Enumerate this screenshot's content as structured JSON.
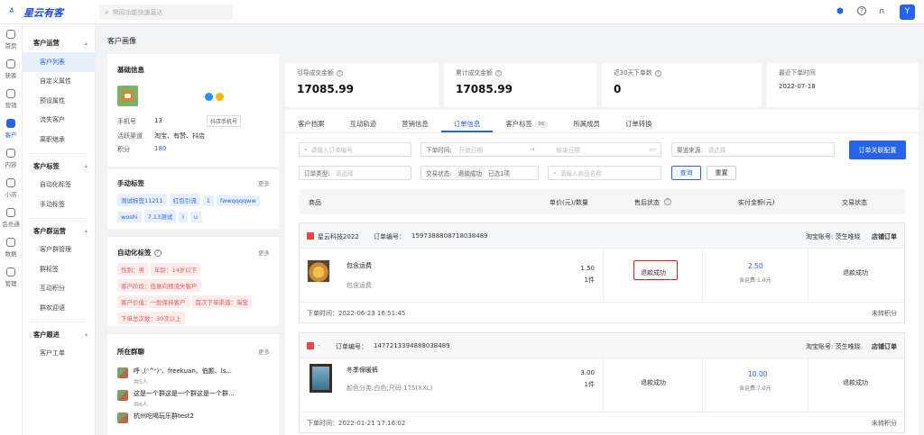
{
  "header": {
    "app_name": "星云有客",
    "search_placeholder": "常用功能快速直达",
    "avatar_text": "Y"
  },
  "rail": [
    {
      "label": "首页",
      "active": false
    },
    {
      "label": "获客",
      "active": false
    },
    {
      "label": "营销",
      "active": false
    },
    {
      "label": "客户",
      "active": true
    },
    {
      "label": "内容",
      "active": false
    },
    {
      "label": "小店",
      "active": false
    },
    {
      "label": "会员通",
      "active": false
    },
    {
      "label": "数据",
      "active": false
    },
    {
      "label": "管理",
      "active": false
    }
  ],
  "sidebar": {
    "groups": [
      {
        "title": "客户运营",
        "items": [
          "客户列表",
          "自定义属性",
          "预设属性",
          "流失客户",
          "离职继承"
        ]
      },
      {
        "title": "客户标签",
        "items": [
          "自动化标签",
          "手动标签"
        ]
      },
      {
        "title": "客户群运营",
        "items": [
          "客户群管理",
          "群标签",
          "互动积分",
          "群欢迎语"
        ]
      },
      {
        "title": "客户跟进",
        "items": [
          "客户工单"
        ]
      }
    ],
    "active_item": "客户列表"
  },
  "page": {
    "breadcrumb": "客户画像"
  },
  "basic": {
    "title": "基础信息",
    "phone_label": "手机号",
    "phone_value": "13",
    "phone_tag": "抖店手机号",
    "channel_label": "活跃渠道",
    "channel_value": "淘宝、有赞、抖店",
    "points_label": "积分",
    "points_value": "180"
  },
  "manual_tags": {
    "title": "手动标签",
    "more": "更多",
    "tags": [
      "测试标签11211",
      "红包引流",
      "1",
      "fwwqqqqww",
      "woshi",
      "7.13测试",
      "i",
      "u"
    ]
  },
  "auto_tags": {
    "title": "自动化标签",
    "more": "更多",
    "tags": [
      "性别：男",
      "年龄：14岁以下",
      "客户阶段：低意向预流失客户",
      "客户价值：一般保持客户",
      "首次下单渠道：淘宝",
      "下单总次数：30次以上"
    ]
  },
  "groups_card": {
    "title": "所在群聊",
    "more": "更多",
    "items": [
      {
        "name": "呼 ,(ᐢ^ᐢ)ᐢ、freekuan、伯颜、ls...",
        "count": "共5人"
      },
      {
        "name": "这是一个群这是一个群这是一个群...",
        "count": "共6人"
      },
      {
        "name": "杭州吃喝玩乐群test2",
        "count": ""
      }
    ]
  },
  "stats": [
    {
      "label": "引导成交金额",
      "value": "17085.99",
      "help": true
    },
    {
      "label": "累计成交金额",
      "value": "17085.99",
      "help": true
    },
    {
      "label": "近30天下单数",
      "value": "0",
      "help": true
    },
    {
      "label": "最近下单时间",
      "value": "2022-07-18",
      "help": false
    }
  ],
  "tabs": [
    {
      "label": "客户档案",
      "count": ""
    },
    {
      "label": "互动轨迹",
      "count": ""
    },
    {
      "label": "营销信息",
      "count": ""
    },
    {
      "label": "订单信息",
      "count": ""
    },
    {
      "label": "客户标签",
      "count": "98"
    },
    {
      "label": "所属成员",
      "count": ""
    },
    {
      "label": "订单转换",
      "count": ""
    }
  ],
  "filters": {
    "order_no_placeholder": "请输入订单编号",
    "order_time_label": "下单时间:",
    "start_placeholder": "开始日期",
    "end_placeholder": "结束日期",
    "channel_label": "渠道来源:",
    "channel_placeholder": "请选择",
    "type_label": "订单类型:",
    "type_placeholder": "请选择",
    "status_label": "交易状态:",
    "status_value": "退款成功",
    "status_selected": "已选1项",
    "product_placeholder": "请输入商品名称",
    "query_button": "查询",
    "reset_button": "重置",
    "config_button": "订单关联配置"
  },
  "table_headers": {
    "product": "商品",
    "price_qty": "单价(元)/数量",
    "after_sale": "售后状态",
    "paid": "实付金额(元)",
    "trade_status": "交易状态"
  },
  "orders": [
    {
      "shop": "星云科技2022",
      "order_no_label": "订单编号：",
      "order_no": "1597388808718038489",
      "account": "淘宝账号: 茨生唯晓",
      "type": "店铺订单",
      "product": "包含运费",
      "spec": "包含运费",
      "price": "1.50",
      "qty": "1件",
      "after_sale": "退款成功",
      "paid": "2.50",
      "shipping": "含运费:1.0元",
      "trade_status": "退款成功",
      "order_time": "下单时间：2022-06-23 16:51:45",
      "points": "未转积分"
    },
    {
      "shop": "-",
      "order_no_label": "订单编号：",
      "order_no": "1477213394888038489",
      "account": "淘宝账号: 茨生唯晓",
      "type": "店铺订单",
      "product": "冬季保暖裤",
      "spec": "颜色分类:白色;尺码:175(XXL)",
      "price": "3.00",
      "qty": "1件",
      "after_sale": "退款成功",
      "paid": "10.00",
      "shipping": "含运费:7.0元",
      "trade_status": "退款成功",
      "order_time": "下单时间：2022-01-21 17:16:02",
      "points": "未转积分"
    }
  ]
}
